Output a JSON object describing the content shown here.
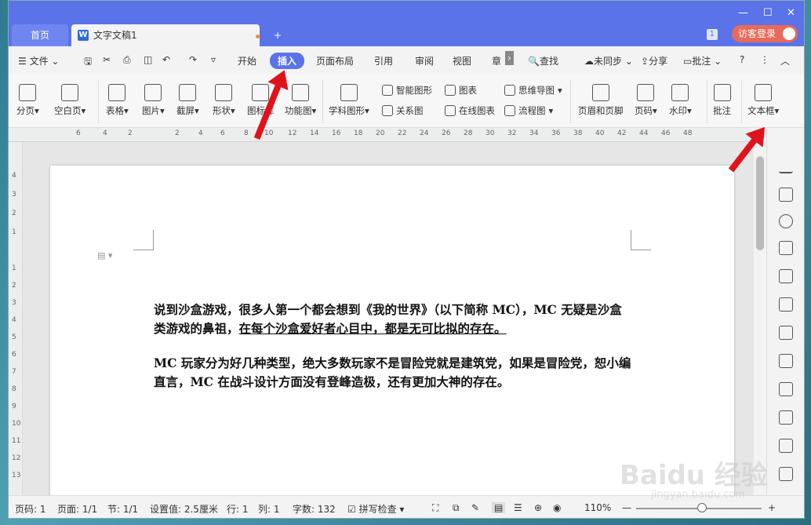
{
  "titlebar": {
    "home_tab": "首页",
    "doc_tab": "文字文稿1",
    "doc_icon": "W",
    "add_tab": "+",
    "badge_count": "1",
    "login": "访客登录"
  },
  "menubar": {
    "file": "文件",
    "items": [
      "开始",
      "插入",
      "页面布局",
      "引用",
      "审阅",
      "视图",
      "章"
    ],
    "search": "查找",
    "sync": "未同步",
    "share": "分享",
    "comment": "批注",
    "help": "?"
  },
  "ribbon": {
    "page_break": "分页",
    "blank_page": "空白页",
    "table": "表格",
    "picture": "图片",
    "screenshot": "截屏",
    "shape": "形状",
    "icon_lib": "图标库",
    "func_chart": "功能图",
    "smart_shape": "智能图形",
    "chart": "图表",
    "mind_map": "思维导图",
    "subject_shape": "学科图形",
    "relation_map": "关系图",
    "online_chart": "在线图表",
    "flowchart": "流程图",
    "header_footer": "页眉和页脚",
    "page_num": "页码",
    "watermark": "水印",
    "comment": "批注",
    "textbox": "文本框"
  },
  "ruler": {
    "h_labels": [
      "6",
      "4",
      "2",
      "2",
      "4",
      "6",
      "8",
      "10",
      "12",
      "14",
      "16",
      "18",
      "20",
      "22",
      "24",
      "26",
      "28",
      "30",
      "32",
      "34",
      "36",
      "38",
      "40",
      "42",
      "44",
      "46",
      "48"
    ],
    "v_labels": [
      "4",
      "3",
      "2",
      "1",
      "1",
      "2",
      "3",
      "4",
      "5",
      "6",
      "7",
      "8",
      "9",
      "10",
      "11",
      "12",
      "13"
    ]
  },
  "document": {
    "p1_a": "说到沙盒游戏，很多人第一个都会想到《我的世界》（以下简称 MC），MC 无疑是沙盒类游戏的鼻祖，",
    "p1_b": "在每个沙盒爱好者心目中，都是无可比拟的存在。",
    "p2": "MC 玩家分为好几种类型，绝大多数玩家不是冒险党就是建筑党，如果是冒险党，恕小编直言，MC 在战斗设计方面没有登峰造极，还有更加大神的存在。"
  },
  "statusbar": {
    "page_num": "页码: 1",
    "page": "页面: 1/1",
    "section": "节: 1/1",
    "setting": "设置值: 2.5厘米",
    "row": "行: 1",
    "col": "列: 1",
    "words": "字数: 132",
    "spellcheck": "拼写检查",
    "zoom": "110%"
  },
  "overlay": {
    "watermark": "Baidu 经验",
    "watermark_url": "jingyan.baidu.com"
  },
  "colors": {
    "titlebar": "#5a73e8",
    "active_tab": "#5a73e8",
    "arrow": "#e0131c",
    "login": "#e86a5a"
  }
}
